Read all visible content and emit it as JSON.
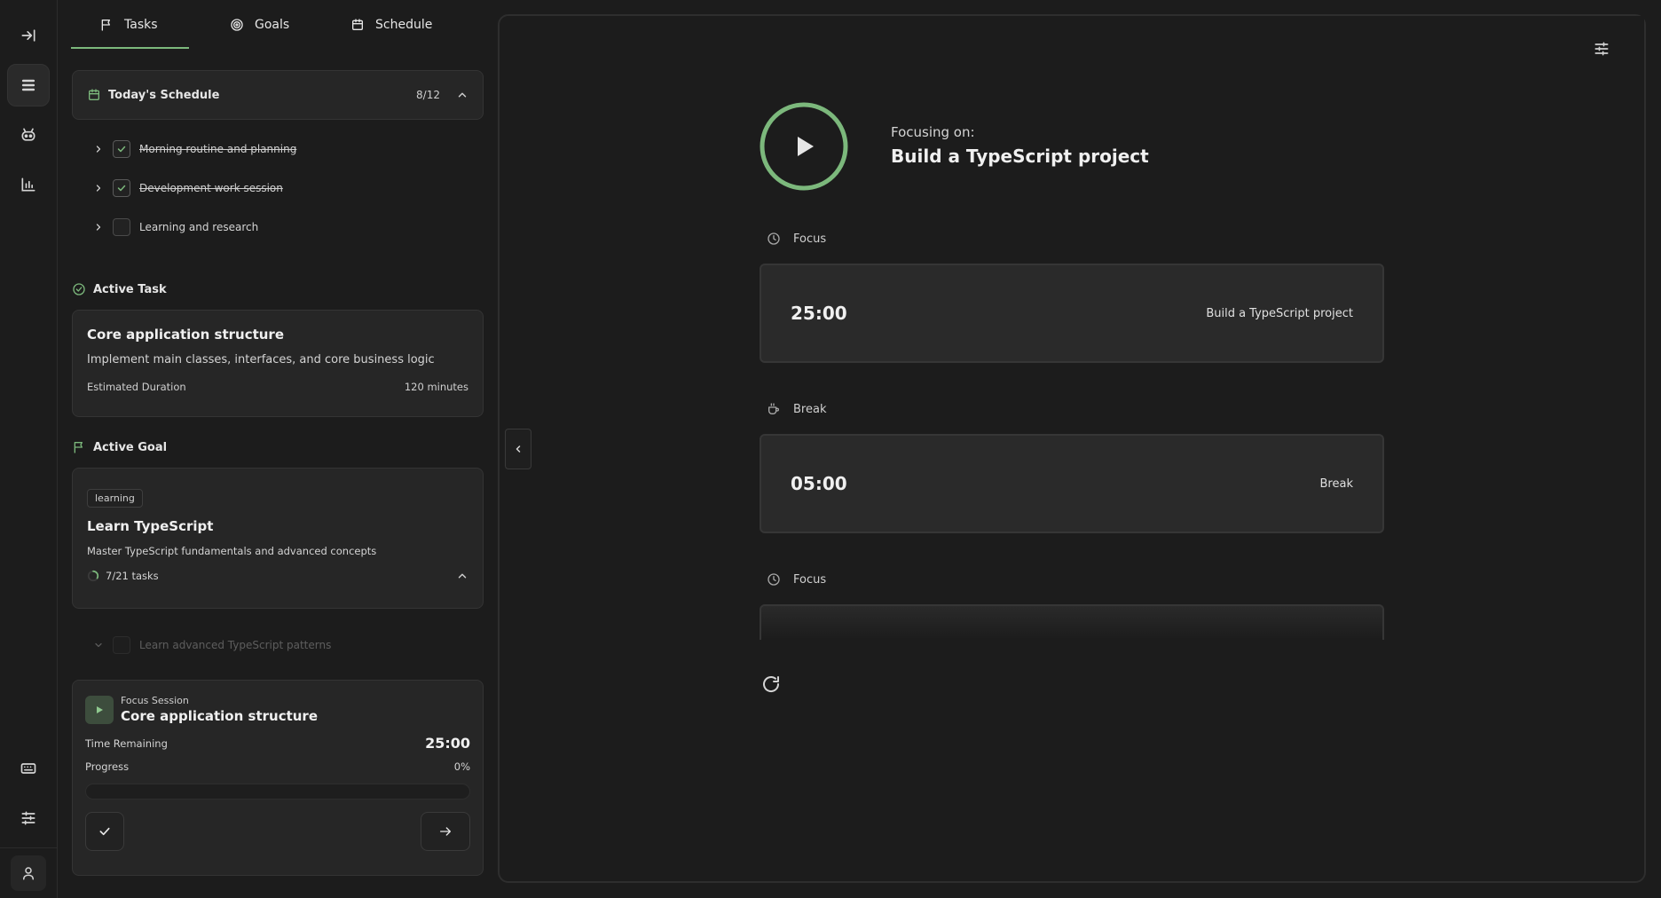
{
  "tabs": [
    {
      "label": "Tasks",
      "icon": "flag-icon",
      "active": true
    },
    {
      "label": "Goals",
      "icon": "target-icon",
      "active": false
    },
    {
      "label": "Schedule",
      "icon": "calendar-icon",
      "active": false
    }
  ],
  "schedule": {
    "title": "Today's Schedule",
    "count": "8/12",
    "items": [
      {
        "label": "Morning routine and planning",
        "done": true
      },
      {
        "label": "Development work session",
        "done": true
      },
      {
        "label": "Learning and research",
        "done": false
      }
    ]
  },
  "active_task": {
    "section_label": "Active Task",
    "title": "Core application structure",
    "description": "Implement main classes, interfaces, and core business logic",
    "duration_label": "Estimated Duration",
    "duration_value": "120 minutes"
  },
  "active_goal": {
    "section_label": "Active Goal",
    "tag": "learning",
    "title": "Learn TypeScript",
    "description": "Master TypeScript fundamentals and advanced concepts",
    "progress_text": "7/21 tasks",
    "progress_fraction": 0.33,
    "subtask": "Learn advanced TypeScript patterns"
  },
  "session": {
    "label": "Focus Session",
    "title": "Core application structure",
    "time_label": "Time Remaining",
    "time_value": "25:00",
    "progress_label": "Progress",
    "progress_value": "0%",
    "progress_fraction": 0
  },
  "main": {
    "focus_caption": "Focusing on:",
    "focus_title": "Build a TypeScript project",
    "blocks": [
      {
        "label": "Focus",
        "icon": "clock-icon",
        "time": "25:00",
        "name": "Build a TypeScript project"
      },
      {
        "label": "Break",
        "icon": "coffee-icon",
        "time": "05:00",
        "name": "Break"
      },
      {
        "label": "Focus",
        "icon": "clock-icon",
        "time": "",
        "name": ""
      }
    ]
  },
  "colors": {
    "accent": "#7cb87c",
    "background": "#1c1c1c",
    "card": "#262626"
  }
}
